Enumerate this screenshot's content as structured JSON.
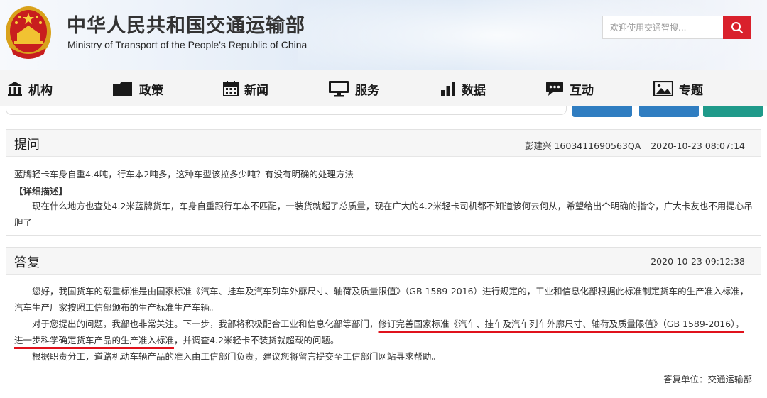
{
  "header": {
    "title_cn": "中华人民共和国交通运输部",
    "title_en": "Ministry of Transport of the People's Republic of China",
    "search_placeholder": "欢迎使用交通智搜...",
    "accent_color": "#d9212c"
  },
  "nav": {
    "items": [
      {
        "label": "机构",
        "icon": "institution-icon"
      },
      {
        "label": "政策",
        "icon": "folder-icon"
      },
      {
        "label": "新闻",
        "icon": "calendar-icon"
      },
      {
        "label": "服务",
        "icon": "monitor-icon"
      },
      {
        "label": "数据",
        "icon": "bar-chart-icon"
      },
      {
        "label": "互动",
        "icon": "chat-bubble-icon"
      },
      {
        "label": "专题",
        "icon": "picture-icon"
      }
    ]
  },
  "question": {
    "heading": "提问",
    "author": "彭建兴",
    "code": "1603411690563QA",
    "time": "2020-10-23 08:07:14",
    "title": "蓝牌轻卡车身自重4.4吨，行车本2吨多，这种车型该拉多少吨？有没有明确的处理方法",
    "detail_label": "【详细描述】",
    "detail_line1": "现在什么地方也查处4.2米蓝牌货车，车身自重跟行车本不匹配，一装货就超了总质量，现在广大的4.2米轻卡司机都不知道该何去何从，希望给出个明确的指令，广大卡友也不",
    "detail_line2": "用提心吊胆了"
  },
  "answer": {
    "heading": "答复",
    "time": "2020-10-23 09:12:38",
    "p1": "您好，我国货车的载重标准是由国家标准《汽车、挂车及汽车列车外廓尺寸、轴荷及质量限值》（GB 1589-2016）进行规定的，工业和信息化部根据此标准制定货车的生产准入标准，汽车生产厂家按照工信部颁布的生产标准生产车辆。",
    "p2_a": "对于您提出的问题，我部也非常关注。下一步，我部将积极配合工业和信息化部等部门，",
    "p2_mark": "修订完善国家标准《汽车、挂车及汽车列车外廓尺寸、轴荷及质量限值》（GB 1589-2016），进一步科学确定货车产品的生产准入标准",
    "p2_b": "，并调查4.2米轻卡不装货就超载的问题。",
    "p3": "根据职责分工，道路机动车辆产品的准入由工信部门负责，建议您将留言提交至工信部门网站寻求帮助。",
    "unit_label": "答复单位：交通运输部"
  },
  "colors": {
    "tile_blue": "#2f7dc1",
    "tile_teal": "#1f9a8a",
    "underline_red": "#e0121c"
  }
}
